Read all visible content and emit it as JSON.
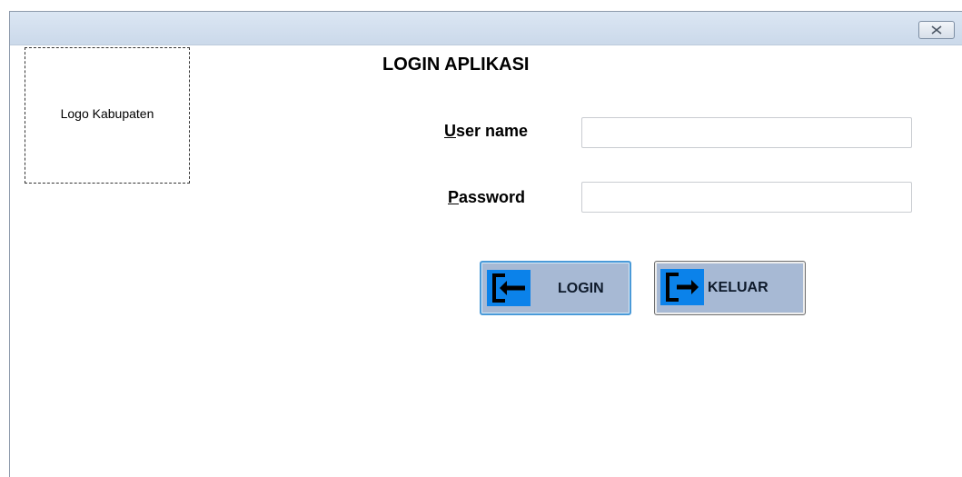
{
  "window": {
    "close_icon": "close-icon"
  },
  "logo": {
    "placeholder_text": "Logo Kabupaten"
  },
  "form": {
    "title": "LOGIN APLIKASI",
    "username": {
      "label_accel": "U",
      "label_rest": "ser name",
      "value": ""
    },
    "password": {
      "label_accel": "P",
      "label_rest": "assword",
      "value": ""
    }
  },
  "buttons": {
    "login": {
      "label": "LOGIN",
      "icon": "login-arrow-icon"
    },
    "keluar": {
      "label": "KELUAR",
      "icon": "exit-arrow-icon"
    }
  },
  "colors": {
    "icon_blue": "#0b82ea",
    "button_face": "#a7b9d4",
    "titlebar": "#cbd9ea"
  }
}
